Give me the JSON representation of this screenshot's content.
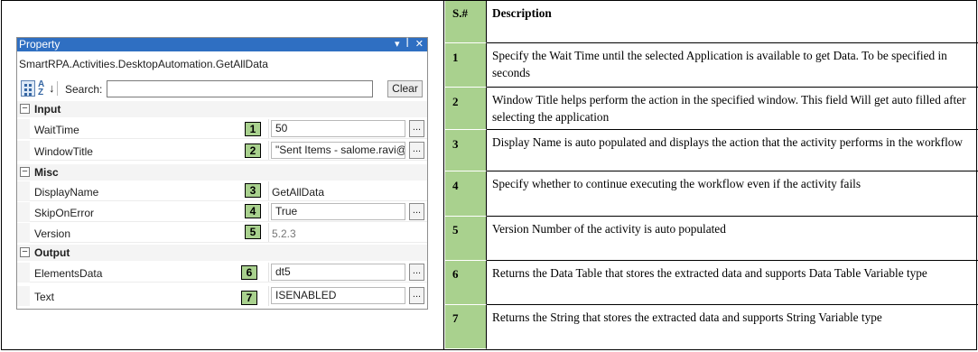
{
  "property_panel": {
    "title": "Property",
    "class_name": "SmartRPA.Activities.DesktopAutomation.GetAllData",
    "search_label": "Search:",
    "search_value": "",
    "clear_label": "Clear",
    "title_icons": {
      "dropdown": "▾",
      "pin": "ꟾ",
      "close": "✕"
    },
    "categories": {
      "input": {
        "toggle": "−",
        "label": "Input"
      },
      "misc": {
        "toggle": "−",
        "label": "Misc"
      },
      "output": {
        "toggle": "−",
        "label": "Output"
      }
    },
    "rows": {
      "wait_time": {
        "name": "WaitTime",
        "value": "50",
        "badge": "1"
      },
      "window_title": {
        "name": "WindowTitle",
        "value": "\"Sent Items - salome.ravi@",
        "badge": "2"
      },
      "display_name": {
        "name": "DisplayName",
        "value": "GetAllData",
        "badge": "3"
      },
      "skip_on_error": {
        "name": "SkipOnError",
        "value": "True",
        "badge": "4"
      },
      "version": {
        "name": "Version",
        "value": "5.2.3",
        "badge": "5"
      },
      "elements_data": {
        "name": "ElementsData",
        "value": "dt5",
        "badge": "6"
      },
      "text": {
        "name": "Text",
        "value": "ISENABLED",
        "badge": "7"
      }
    },
    "ellipsis": "..."
  },
  "description_table": {
    "header": {
      "number": "S.#",
      "description": "Description"
    },
    "rows": [
      {
        "number": "1",
        "description": "Specify the Wait Time until the selected  Application is available to get Data. To be specified in seconds"
      },
      {
        "number": "2",
        "description": "Window Title helps perform the action in the specified window. This field Will get auto filled after selecting the application"
      },
      {
        "number": "3",
        "description": "Display Name is auto populated and displays the action that the activity performs in the workflow"
      },
      {
        "number": "4",
        "description": "Specify whether to continue executing the workflow even if the activity fails"
      },
      {
        "number": "5",
        "description": "Version Number of the activity is auto populated"
      },
      {
        "number": "6",
        "description": "Returns the Data Table that stores the extracted data and supports Data Table Variable type"
      },
      {
        "number": "7",
        "description": "Returns the String that stores the extracted data and supports String Variable type"
      }
    ]
  },
  "colors": {
    "badge_green": "#a9d18e",
    "titlebar_blue": "#2f6fc2"
  }
}
